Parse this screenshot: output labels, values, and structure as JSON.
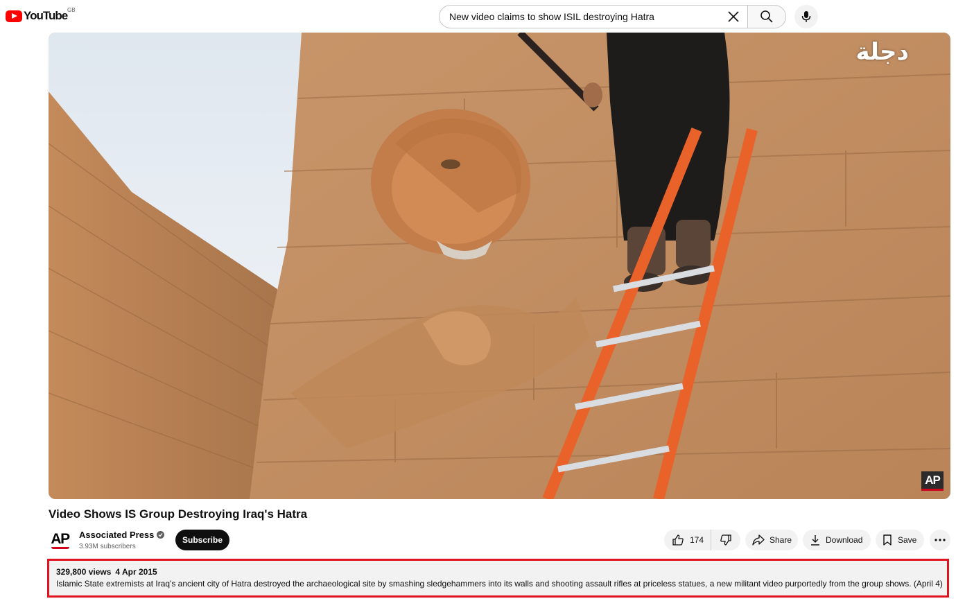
{
  "header": {
    "logo_text": "YouTube",
    "region": "GB",
    "search_value": "New video claims to show ISIL destroying Hatra"
  },
  "video": {
    "watermark_channel": "AP",
    "watermark_arabic": "دجلة",
    "title": "Video Shows IS Group Destroying Iraq's Hatra"
  },
  "channel": {
    "avatar_text": "AP",
    "name": "Associated Press",
    "subscribers": "3.93M subscribers",
    "subscribe_label": "Subscribe"
  },
  "actions": {
    "likes": "174",
    "share_label": "Share",
    "download_label": "Download",
    "save_label": "Save"
  },
  "description": {
    "views": "329,800 views",
    "date": "4 Apr 2015",
    "text": "Islamic State extremists at Iraq's ancient city of Hatra destroyed the archaeological site by smashing sledgehammers into its walls and shooting assault rifles at priceless statues, a new militant video purportedly from the group shows. (April 4)"
  },
  "colors": {
    "brand_red": "#ff0000",
    "highlight_border": "#e0141e",
    "ap_red": "#d0021b"
  }
}
